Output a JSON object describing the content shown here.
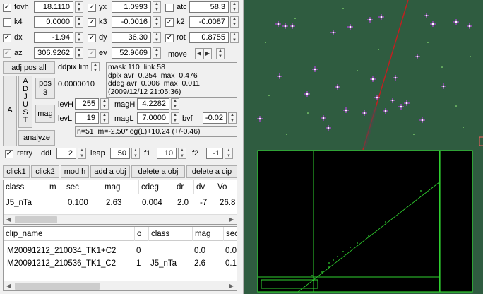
{
  "row1": {
    "fovh_label": "fovh",
    "fovh_value": "18.1110",
    "yx_label": "yx",
    "yx_value": "1.0993",
    "atc_label": "atc",
    "atc_value": "58.3"
  },
  "row2": {
    "k4_label": "k4",
    "k4_value": "0.0000",
    "k3_label": "k3",
    "k3_value": "-0.0016",
    "k2_label": "k2",
    "k2_value": "-0.0087"
  },
  "row3": {
    "dx_label": "dx",
    "dx_value": "-1.94",
    "dy_label": "dy",
    "dy_value": "36.30",
    "rot_label": "rot",
    "rot_value": "0.8755"
  },
  "row4": {
    "az_label": "az",
    "az_value": "306.9262",
    "ev_label": "ev",
    "ev_value": "52.9669",
    "move_label": "move"
  },
  "fit": {
    "adj_pos_all": "adj pos all",
    "ddpix_label": "ddpix lim",
    "ddpix_value": "0.0000010",
    "adjust_letters": "A\nD\nJ\nU\nS\nT",
    "a_label": "A",
    "pos3": "pos\n3",
    "mag": "mag",
    "analyze": "analyze",
    "stats": "mask 110  link 58\ndpix avr  0.254  max  0.476\nddeg avr  0.006  max  0.011\n(2009/12/12 21:05:36)",
    "levH_label": "levH",
    "levH_value": "255",
    "magH_label": "magH",
    "magH_value": "4.2282",
    "levL_label": "levL",
    "levL_value": "19",
    "magL_label": "magL",
    "magL_value": "7.0000",
    "bvf_label": "bvf",
    "bvf_value": "-0.02",
    "formula": "n=51  m=-2.50*log(L)+10.24 (+/-0.46)"
  },
  "retry_row": {
    "retry_label": "retry",
    "ddl_label": "ddl",
    "ddl_value": "2",
    "leap_label": "leap",
    "leap_value": "50",
    "f1_label": "f1",
    "f1_value": "10",
    "f2_label": "f2",
    "f2_value": "-1"
  },
  "actions": [
    "click1",
    "click2",
    "mod h",
    "add a obj",
    "delete a obj",
    "delete a cip"
  ],
  "obj_table": {
    "columns": [
      "class",
      "m",
      "sec",
      "mag",
      "cdeg",
      "dr",
      "dv",
      "Vo"
    ],
    "rows": [
      [
        "J5_nTa",
        "",
        "0.100",
        "2.63",
        "0.004",
        "2.0",
        "-7",
        "26.8"
      ]
    ]
  },
  "clip_table": {
    "columns": [
      "clip_name",
      "o",
      "class",
      "mag",
      "sec"
    ],
    "rows": [
      [
        "M20091212_210034_TK1+C2",
        "0",
        "",
        "0.0",
        "0.0"
      ],
      [
        "M20091212_210536_TK1_C2",
        "1",
        "J5_nTa",
        "2.6",
        "0.1"
      ]
    ]
  },
  "sky": {
    "background": "#2f5c40",
    "star_color": "#d040ff",
    "meteor_color": "#c02020",
    "frame_color": "#30d030"
  }
}
